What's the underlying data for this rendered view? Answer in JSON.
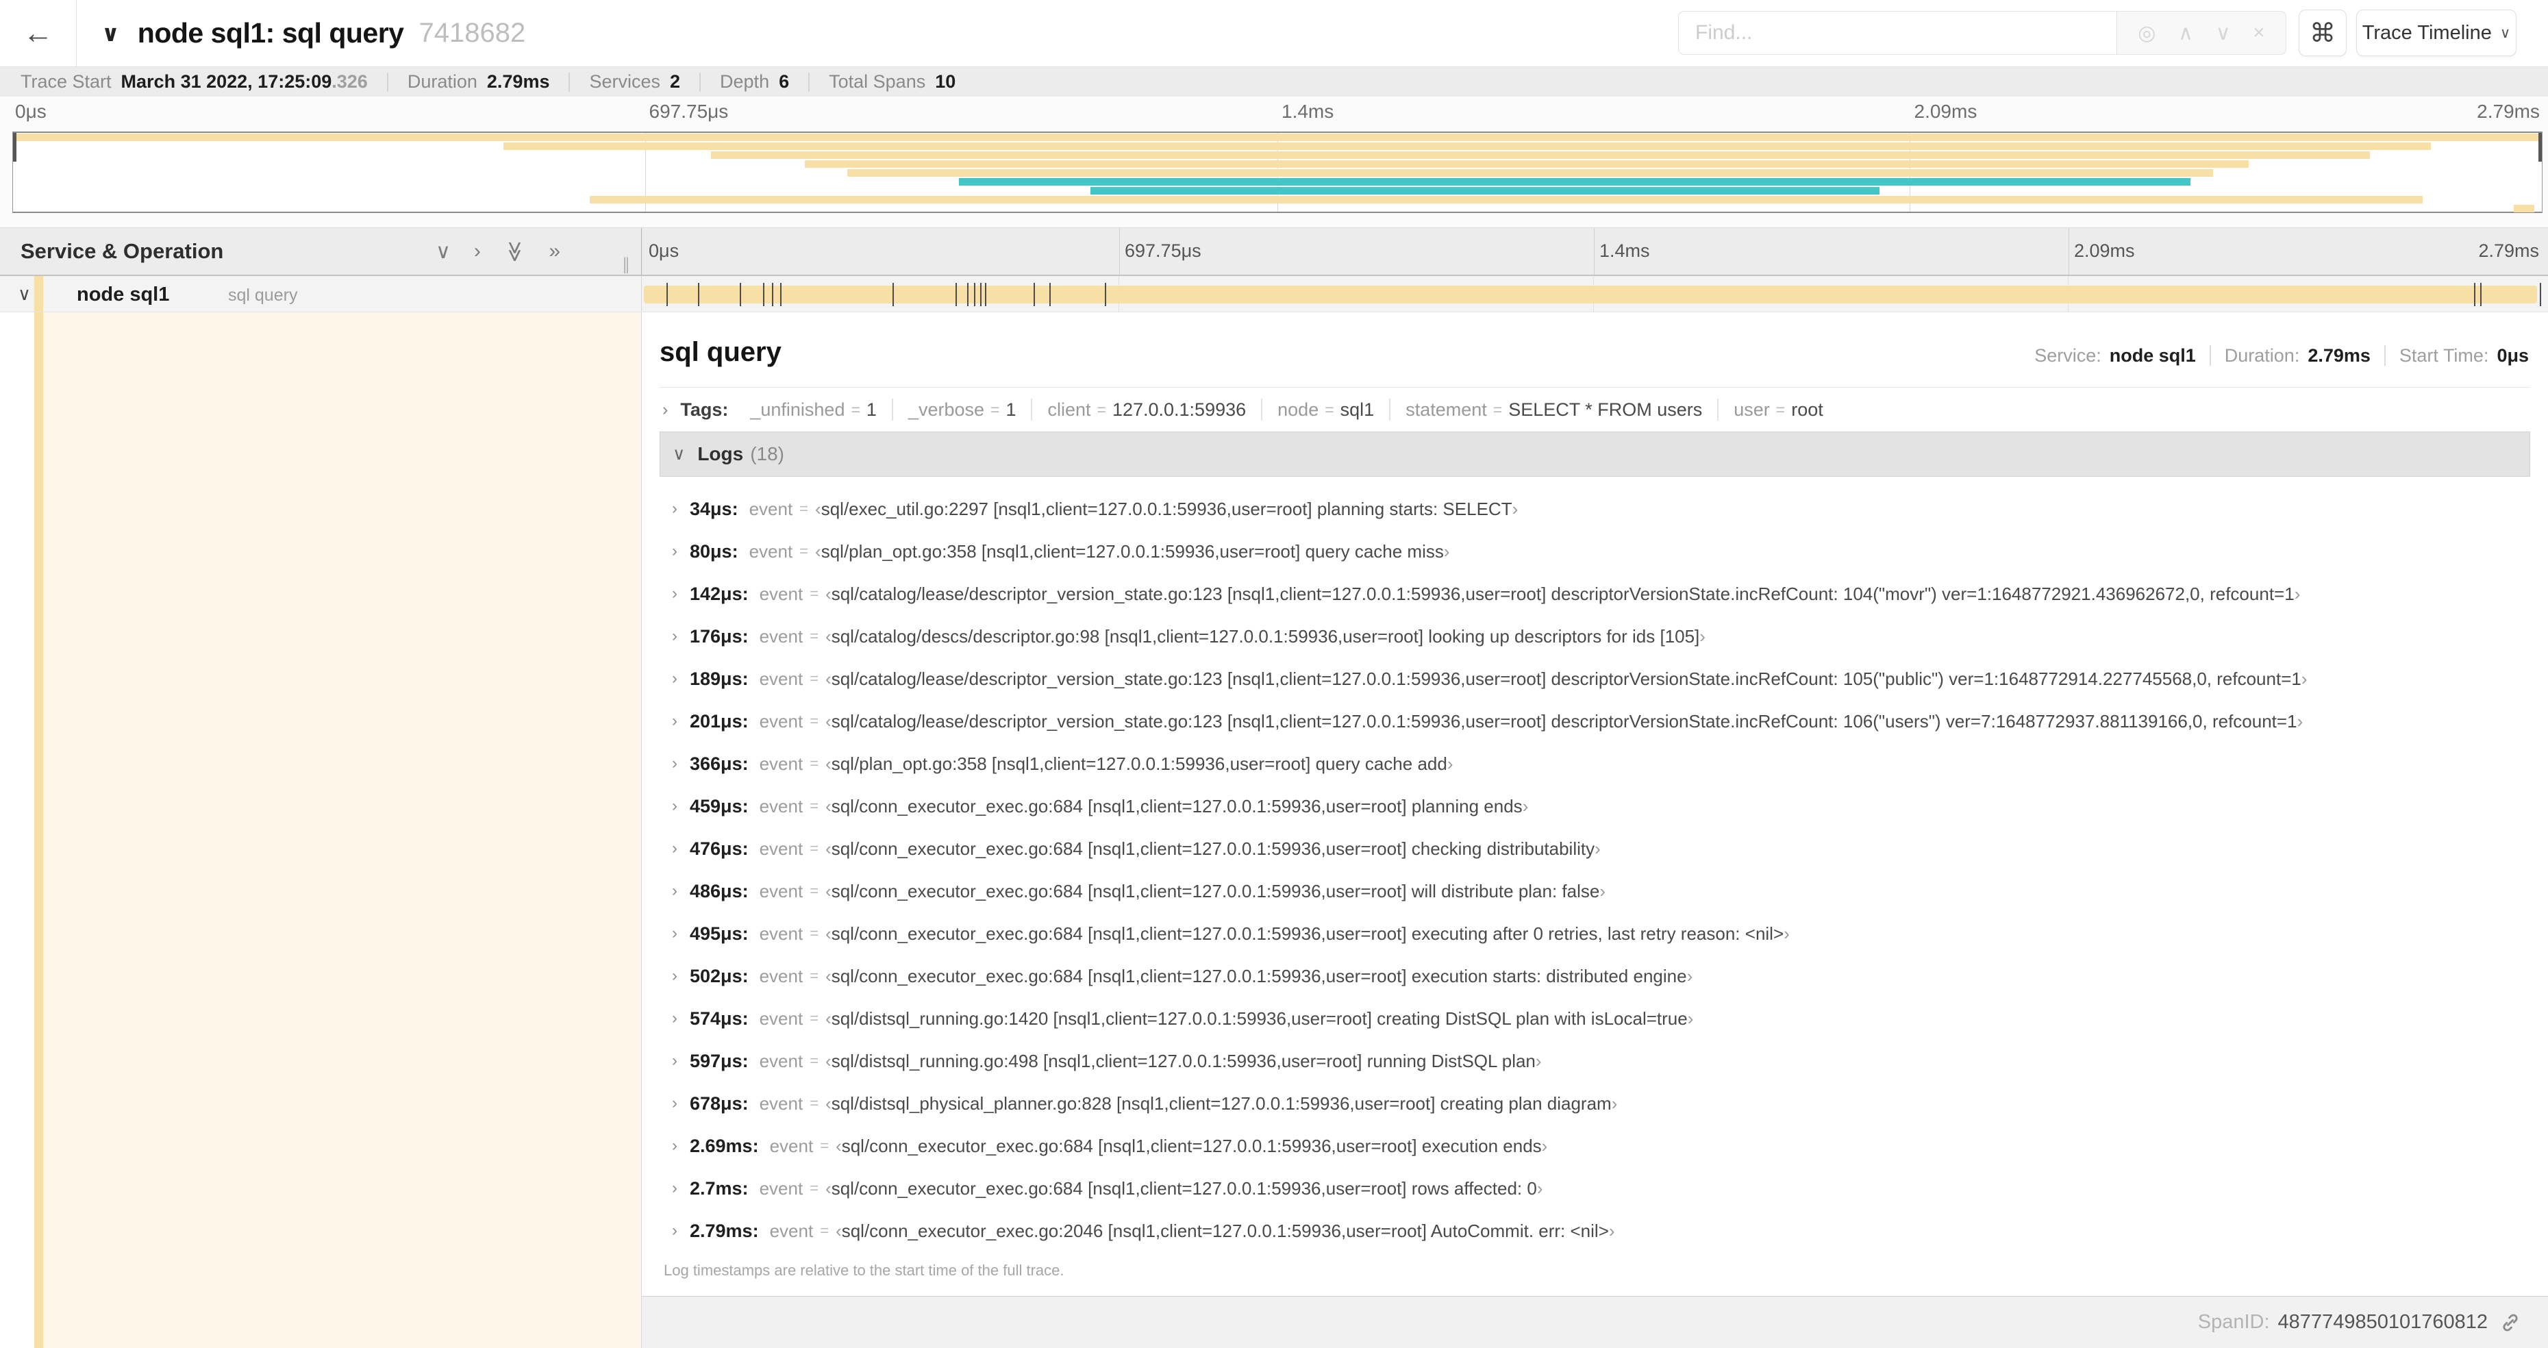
{
  "window": {
    "back_icon": "←",
    "collapse_chevron": "∨",
    "title": "node sql1: sql query",
    "trace_id": "7418682"
  },
  "search": {
    "placeholder": "Find...",
    "target_icon": "◎",
    "prev_icon": "∧",
    "next_icon": "∨",
    "clear_icon": "×",
    "shortcut_icon": "⌘"
  },
  "view_dropdown": {
    "label": "Trace Timeline",
    "caret": "∨"
  },
  "trace_info": {
    "items": [
      {
        "label": "Trace Start",
        "value": "March 31 2022, 17:25:09",
        "suffix": ".326"
      },
      {
        "label": "Duration",
        "value": "2.79ms",
        "suffix": ""
      },
      {
        "label": "Services",
        "value": "2",
        "suffix": ""
      },
      {
        "label": "Depth",
        "value": "6",
        "suffix": ""
      },
      {
        "label": "Total Spans",
        "value": "10",
        "suffix": ""
      }
    ]
  },
  "timeline": {
    "ticks": [
      "0μs",
      "697.75μs",
      "1.4ms",
      "2.09ms",
      "2.79ms"
    ],
    "colors": {
      "orange": "#F7DFA6",
      "teal": "#44C5C8"
    },
    "minimap_spans": [
      {
        "row": 0,
        "start_pct": 0,
        "end_pct": 100,
        "color": "orange"
      },
      {
        "row": 1,
        "start_pct": 19.4,
        "end_pct": 95.6,
        "color": "orange"
      },
      {
        "row": 2,
        "start_pct": 27.6,
        "end_pct": 93.2,
        "color": "orange"
      },
      {
        "row": 3,
        "start_pct": 31.3,
        "end_pct": 88.4,
        "color": "orange"
      },
      {
        "row": 4,
        "start_pct": 33.0,
        "end_pct": 87.0,
        "color": "orange"
      },
      {
        "row": 5,
        "start_pct": 37.4,
        "end_pct": 86.1,
        "color": "teal"
      },
      {
        "row": 6,
        "start_pct": 42.6,
        "end_pct": 73.8,
        "color": "teal"
      },
      {
        "row": 7,
        "start_pct": 22.8,
        "end_pct": 95.3,
        "color": "orange"
      },
      {
        "row": 8,
        "start_pct": 98.9,
        "end_pct": 99.7,
        "color": "orange"
      }
    ]
  },
  "grid": {
    "header_label": "Service & Operation",
    "collapse_icons": [
      "∨",
      "›",
      "≫",
      "»"
    ],
    "resizer": "∥"
  },
  "span_row": {
    "chevron": "∨",
    "service": "node sql1",
    "operation": "sql query",
    "log_marks_pct": [
      1.22,
      2.87,
      5.09,
      6.31,
      6.77,
      7.2,
      13.12,
      16.45,
      17.06,
      17.42,
      17.74,
      18.0,
      20.57,
      21.4,
      24.3,
      96.42,
      96.77,
      99.9
    ]
  },
  "detail": {
    "title": "sql query",
    "overview": [
      {
        "label": "Service:",
        "value": "node sql1"
      },
      {
        "label": "Duration:",
        "value": "2.79ms"
      },
      {
        "label": "Start Time:",
        "value": "0μs"
      }
    ],
    "tags": {
      "chevron": "›",
      "label": "Tags:",
      "items": [
        {
          "key": "_unfinished",
          "value": "1"
        },
        {
          "key": "_verbose",
          "value": "1"
        },
        {
          "key": "client",
          "value": "127.0.0.1:59936"
        },
        {
          "key": "node",
          "value": "sql1"
        },
        {
          "key": "statement",
          "value": "SELECT * FROM users"
        },
        {
          "key": "user",
          "value": "root"
        }
      ]
    },
    "logs": {
      "chevron": "∨",
      "label": "Logs",
      "count": "(18)",
      "row_chevron": "›",
      "field": "event",
      "eq": "=",
      "quote_open": "‹",
      "quote_close": "›",
      "entries": [
        {
          "time": "34μs:",
          "value": "sql/exec_util.go:2297 [nsql1,client=127.0.0.1:59936,user=root] planning starts: SELECT"
        },
        {
          "time": "80μs:",
          "value": "sql/plan_opt.go:358 [nsql1,client=127.0.0.1:59936,user=root] query cache miss"
        },
        {
          "time": "142μs:",
          "value": "sql/catalog/lease/descriptor_version_state.go:123 [nsql1,client=127.0.0.1:59936,user=root] descriptorVersionState.incRefCount: 104(\"movr\") ver=1:1648772921.436962672,0, refcount=1"
        },
        {
          "time": "176μs:",
          "value": "sql/catalog/descs/descriptor.go:98 [nsql1,client=127.0.0.1:59936,user=root] looking up descriptors for ids [105]"
        },
        {
          "time": "189μs:",
          "value": "sql/catalog/lease/descriptor_version_state.go:123 [nsql1,client=127.0.0.1:59936,user=root] descriptorVersionState.incRefCount: 105(\"public\") ver=1:1648772914.227745568,0, refcount=1"
        },
        {
          "time": "201μs:",
          "value": "sql/catalog/lease/descriptor_version_state.go:123 [nsql1,client=127.0.0.1:59936,user=root] descriptorVersionState.incRefCount: 106(\"users\") ver=7:1648772937.881139166,0, refcount=1"
        },
        {
          "time": "366μs:",
          "value": "sql/plan_opt.go:358 [nsql1,client=127.0.0.1:59936,user=root] query cache add"
        },
        {
          "time": "459μs:",
          "value": "sql/conn_executor_exec.go:684 [nsql1,client=127.0.0.1:59936,user=root] planning ends"
        },
        {
          "time": "476μs:",
          "value": "sql/conn_executor_exec.go:684 [nsql1,client=127.0.0.1:59936,user=root] checking distributability"
        },
        {
          "time": "486μs:",
          "value": "sql/conn_executor_exec.go:684 [nsql1,client=127.0.0.1:59936,user=root] will distribute plan: false"
        },
        {
          "time": "495μs:",
          "value": "sql/conn_executor_exec.go:684 [nsql1,client=127.0.0.1:59936,user=root] executing after 0 retries, last retry reason: <nil>"
        },
        {
          "time": "502μs:",
          "value": "sql/conn_executor_exec.go:684 [nsql1,client=127.0.0.1:59936,user=root] execution starts: distributed engine"
        },
        {
          "time": "574μs:",
          "value": "sql/distsql_running.go:1420 [nsql1,client=127.0.0.1:59936,user=root] creating DistSQL plan with isLocal=true"
        },
        {
          "time": "597μs:",
          "value": "sql/distsql_running.go:498 [nsql1,client=127.0.0.1:59936,user=root] running DistSQL plan"
        },
        {
          "time": "678μs:",
          "value": "sql/distsql_physical_planner.go:828 [nsql1,client=127.0.0.1:59936,user=root] creating plan diagram"
        },
        {
          "time": "2.69ms:",
          "value": "sql/conn_executor_exec.go:684 [nsql1,client=127.0.0.1:59936,user=root] execution ends"
        },
        {
          "time": "2.7ms:",
          "value": "sql/conn_executor_exec.go:684 [nsql1,client=127.0.0.1:59936,user=root] rows affected: 0"
        },
        {
          "time": "2.79ms:",
          "value": "sql/conn_executor_exec.go:2046 [nsql1,client=127.0.0.1:59936,user=root] AutoCommit. err: <nil>"
        }
      ]
    },
    "footer_note": "Log timestamps are relative to the start time of the full trace.",
    "span_id": {
      "label": "SpanID:",
      "value": "4877749850101760812"
    }
  }
}
